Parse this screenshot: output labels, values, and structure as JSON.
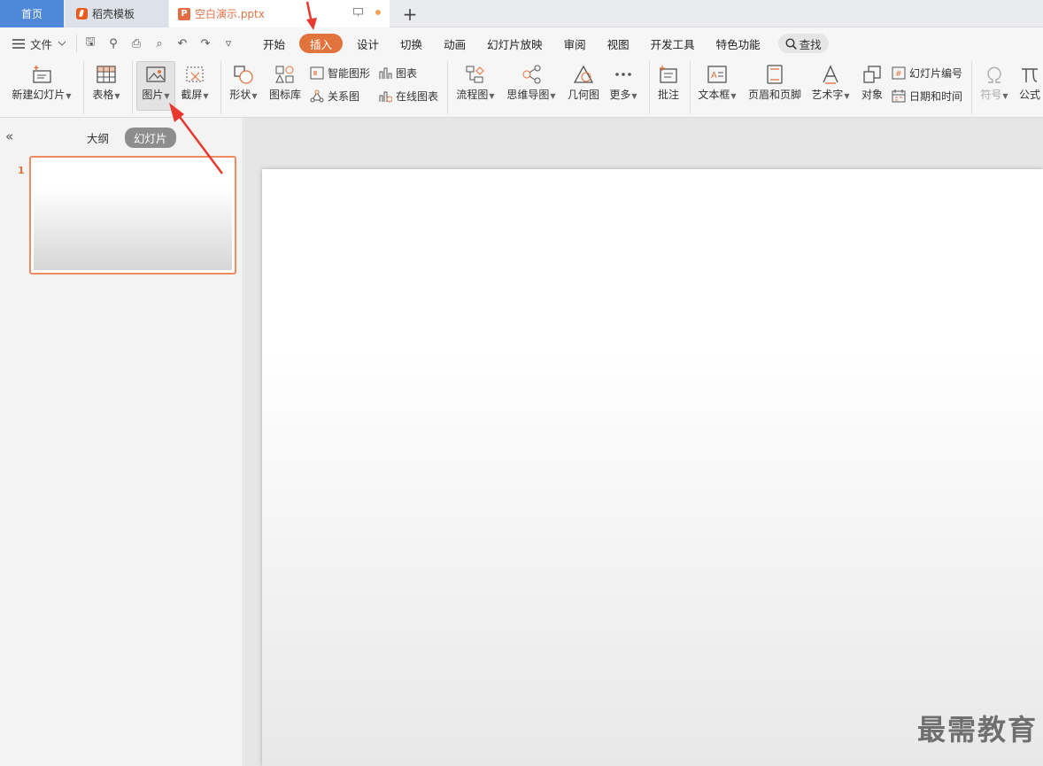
{
  "titlebar": {
    "home_tab": "首页",
    "template_tab": "稻壳模板",
    "doc_tab": "空白演示.pptx",
    "add_tab": "+"
  },
  "menubar": {
    "file": "文件",
    "tabs": [
      "开始",
      "插入",
      "设计",
      "切换",
      "动画",
      "幻灯片放映",
      "审阅",
      "视图",
      "开发工具",
      "特色功能"
    ],
    "active_tab": "插入",
    "search": "查找"
  },
  "ribbon": {
    "new_slide": "新建幻灯片",
    "table": "表格",
    "picture": "图片",
    "screenshot": "截屏",
    "shape": "形状",
    "icon_lib": "图标库",
    "smart_art": "智能图形",
    "relation": "关系图",
    "chart": "图表",
    "online_chart": "在线图表",
    "flowchart": "流程图",
    "mindmap": "思维导图",
    "geometry": "几何图",
    "more": "更多",
    "comment": "批注",
    "textbox": "文本框",
    "header_footer": "页眉和页脚",
    "art_text": "艺术字",
    "object": "对象",
    "slide_number": "幻灯片编号",
    "date_time": "日期和时间",
    "symbol": "符号",
    "formula": "公式"
  },
  "left_panel": {
    "outline_tab": "大纲",
    "slides_tab": "幻灯片",
    "slide_number": "1"
  },
  "watermark": "最需教育",
  "colors": {
    "accent": "#e2733d",
    "home_tab": "#4f88d8",
    "annotation_arrow": "#e8382f"
  }
}
